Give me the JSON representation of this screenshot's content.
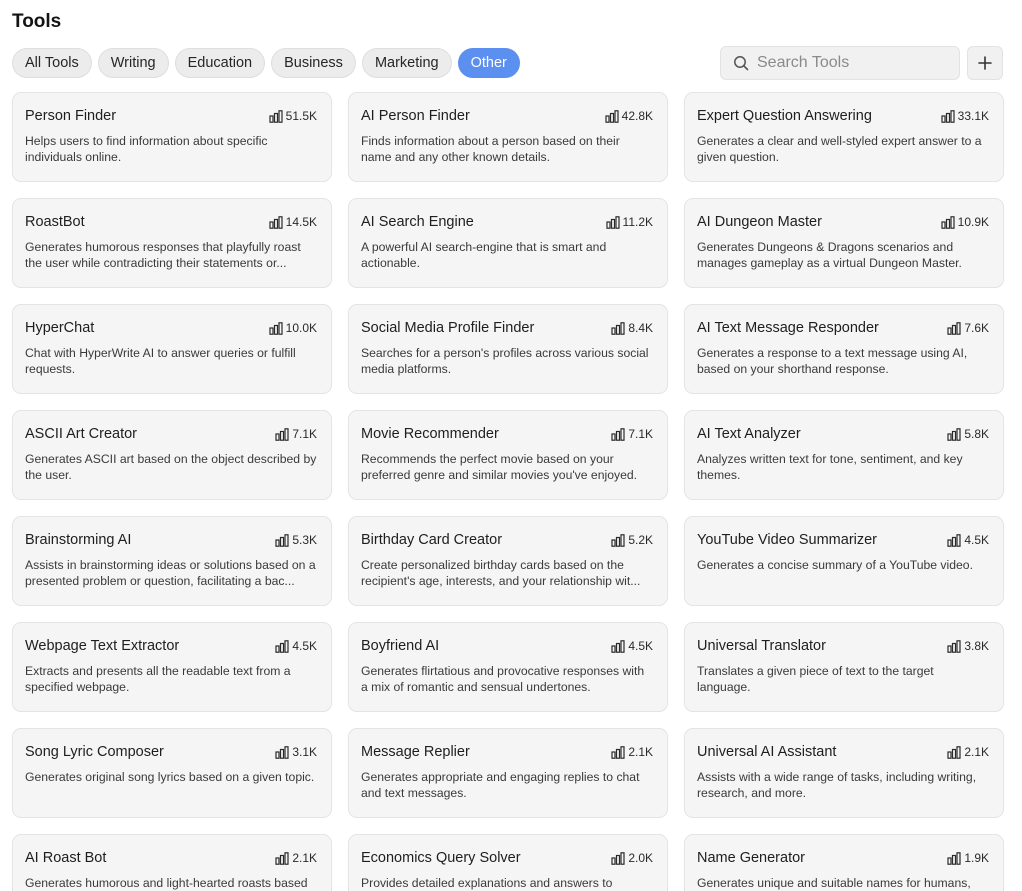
{
  "page": {
    "title": "Tools"
  },
  "filters": [
    {
      "label": "All Tools",
      "active": false
    },
    {
      "label": "Writing",
      "active": false
    },
    {
      "label": "Education",
      "active": false
    },
    {
      "label": "Business",
      "active": false
    },
    {
      "label": "Marketing",
      "active": false
    },
    {
      "label": "Other",
      "active": true
    }
  ],
  "search": {
    "placeholder": "Search Tools",
    "value": "",
    "icon": "search-icon"
  },
  "add_button": {
    "label": "+",
    "icon": "plus-icon"
  },
  "colors": {
    "accent": "#5b8ff0",
    "card_bg": "#f5f5f5",
    "chip_bg": "#ececec"
  },
  "tools": [
    {
      "title": "Person Finder",
      "count": "51.5K",
      "desc": "Helps users to find information about specific individuals online."
    },
    {
      "title": "AI Person Finder",
      "count": "42.8K",
      "desc": "Finds information about a person based on their name and any other known details."
    },
    {
      "title": "Expert Question Answering",
      "count": "33.1K",
      "desc": "Generates a clear and well-styled expert answer to a given question."
    },
    {
      "title": "RoastBot",
      "count": "14.5K",
      "desc": "Generates humorous responses that playfully roast the user while contradicting their statements or..."
    },
    {
      "title": "AI Search Engine",
      "count": "11.2K",
      "desc": "A powerful AI search-engine that is smart and actionable."
    },
    {
      "title": "AI Dungeon Master",
      "count": "10.9K",
      "desc": "Generates Dungeons & Dragons scenarios and manages gameplay as a virtual Dungeon Master."
    },
    {
      "title": "HyperChat",
      "count": "10.0K",
      "desc": "Chat with HyperWrite AI to answer queries or fulfill requests."
    },
    {
      "title": "Social Media Profile Finder",
      "count": "8.4K",
      "desc": "Searches for a person's profiles across various social media platforms."
    },
    {
      "title": "AI Text Message Responder",
      "count": "7.6K",
      "desc": "Generates a response to a text message using AI, based on your shorthand response."
    },
    {
      "title": "ASCII Art Creator",
      "count": "7.1K",
      "desc": "Generates ASCII art based on the object described by the user."
    },
    {
      "title": "Movie Recommender",
      "count": "7.1K",
      "desc": "Recommends the perfect movie based on your preferred genre and similar movies you've enjoyed."
    },
    {
      "title": "AI Text Analyzer",
      "count": "5.8K",
      "desc": "Analyzes written text for tone, sentiment, and key themes."
    },
    {
      "title": "Brainstorming AI",
      "count": "5.3K",
      "desc": "Assists in brainstorming ideas or solutions based on a presented problem or question, facilitating a bac..."
    },
    {
      "title": "Birthday Card Creator",
      "count": "5.2K",
      "desc": "Create personalized birthday cards based on the recipient's age, interests, and your relationship wit..."
    },
    {
      "title": "YouTube Video Summarizer",
      "count": "4.5K",
      "desc": "Generates a concise summary of a YouTube video."
    },
    {
      "title": "Webpage Text Extractor",
      "count": "4.5K",
      "desc": "Extracts and presents all the readable text from a specified webpage."
    },
    {
      "title": "Boyfriend AI",
      "count": "4.5K",
      "desc": "Generates flirtatious and provocative responses with a mix of romantic and sensual undertones."
    },
    {
      "title": "Universal Translator",
      "count": "3.8K",
      "desc": "Translates a given piece of text to the target language."
    },
    {
      "title": "Song Lyric Composer",
      "count": "3.1K",
      "desc": "Generates original song lyrics based on a given topic."
    },
    {
      "title": "Message Replier",
      "count": "2.1K",
      "desc": "Generates appropriate and engaging replies to chat and text messages."
    },
    {
      "title": "Universal AI Assistant",
      "count": "2.1K",
      "desc": "Assists with a wide range of tasks, including writing, research, and more."
    },
    {
      "title": "AI Roast Bot",
      "count": "2.1K",
      "desc": "Generates humorous and light-hearted roasts based"
    },
    {
      "title": "Economics Query Solver",
      "count": "2.0K",
      "desc": "Provides detailed explanations and answers to"
    },
    {
      "title": "Name Generator",
      "count": "1.9K",
      "desc": "Generates unique and suitable names for humans,"
    }
  ]
}
